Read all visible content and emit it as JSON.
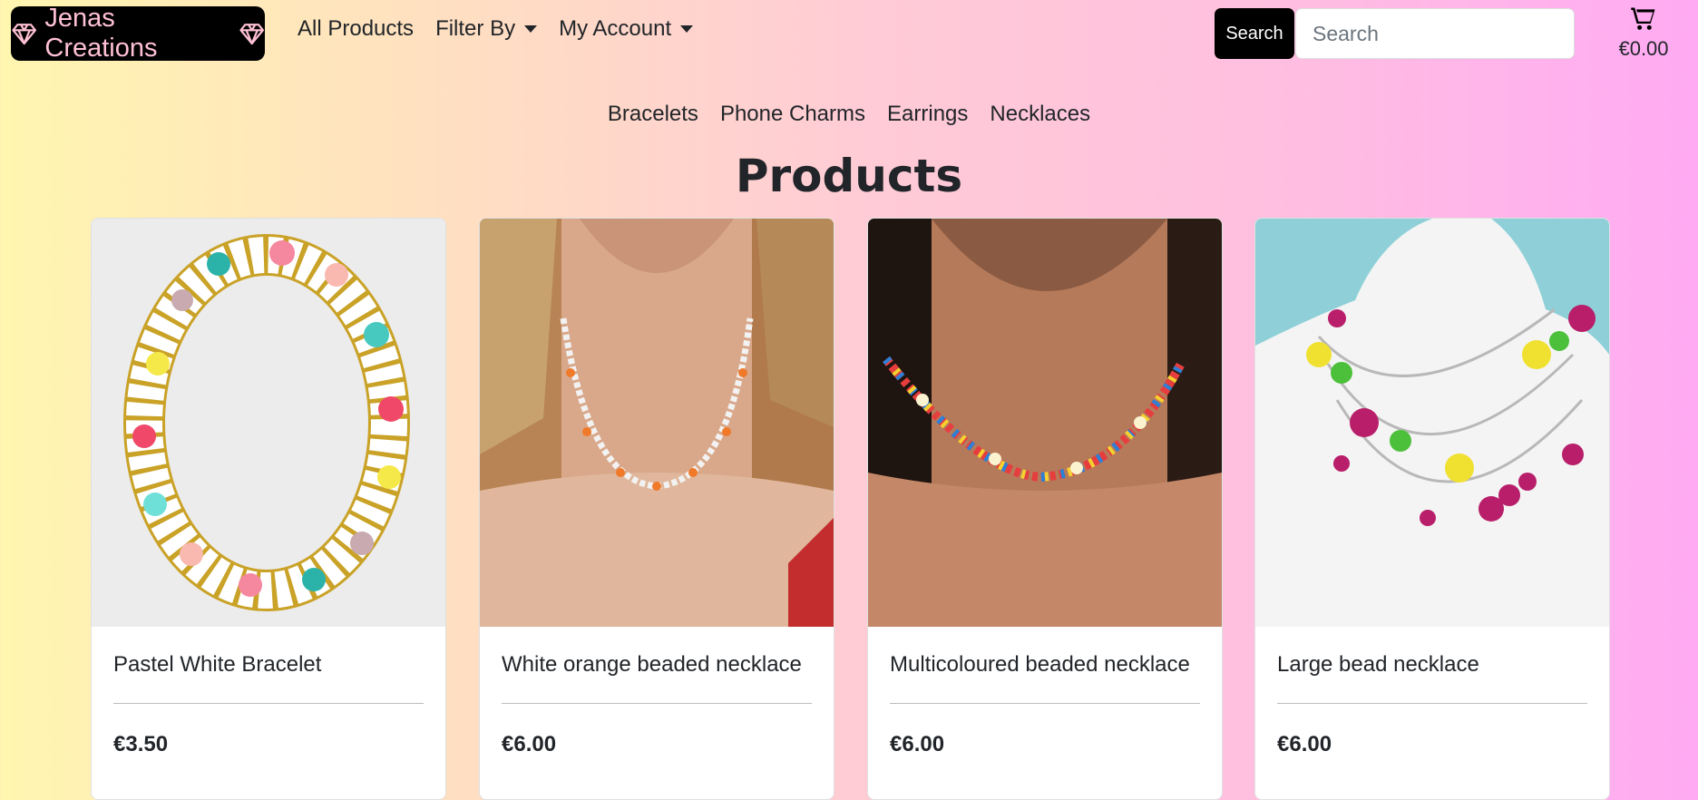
{
  "brand": {
    "name": "Jenas Creations",
    "color": "#ffc1d4"
  },
  "nav": {
    "all_products": "All Products",
    "filter_by": "Filter By",
    "my_account": "My Account"
  },
  "search": {
    "button": "Search",
    "placeholder": "Search"
  },
  "cart": {
    "icon": "shopping-cart-icon",
    "total": "€0.00"
  },
  "categories": [
    "Bracelets",
    "Phone Charms",
    "Earrings",
    "Necklaces"
  ],
  "page_title": "Products",
  "products": [
    {
      "name": "Pastel White Bracelet",
      "price": "€3.50"
    },
    {
      "name": "White orange beaded necklace",
      "price": "€6.00"
    },
    {
      "name": "Multicoloured beaded necklace",
      "price": "€6.00"
    },
    {
      "name": "Large bead necklace",
      "price": "€6.00"
    }
  ]
}
